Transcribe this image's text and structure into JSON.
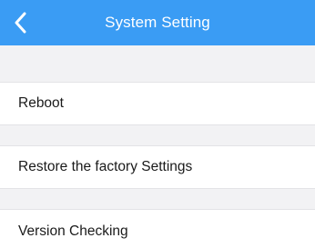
{
  "nav": {
    "title": "System Setting",
    "back_icon": "chevron-left-icon",
    "background_color": "#3a9cf4"
  },
  "settings": {
    "items": [
      {
        "label": "Reboot"
      },
      {
        "label": "Restore the factory Settings"
      },
      {
        "label": "Version Checking"
      }
    ]
  }
}
